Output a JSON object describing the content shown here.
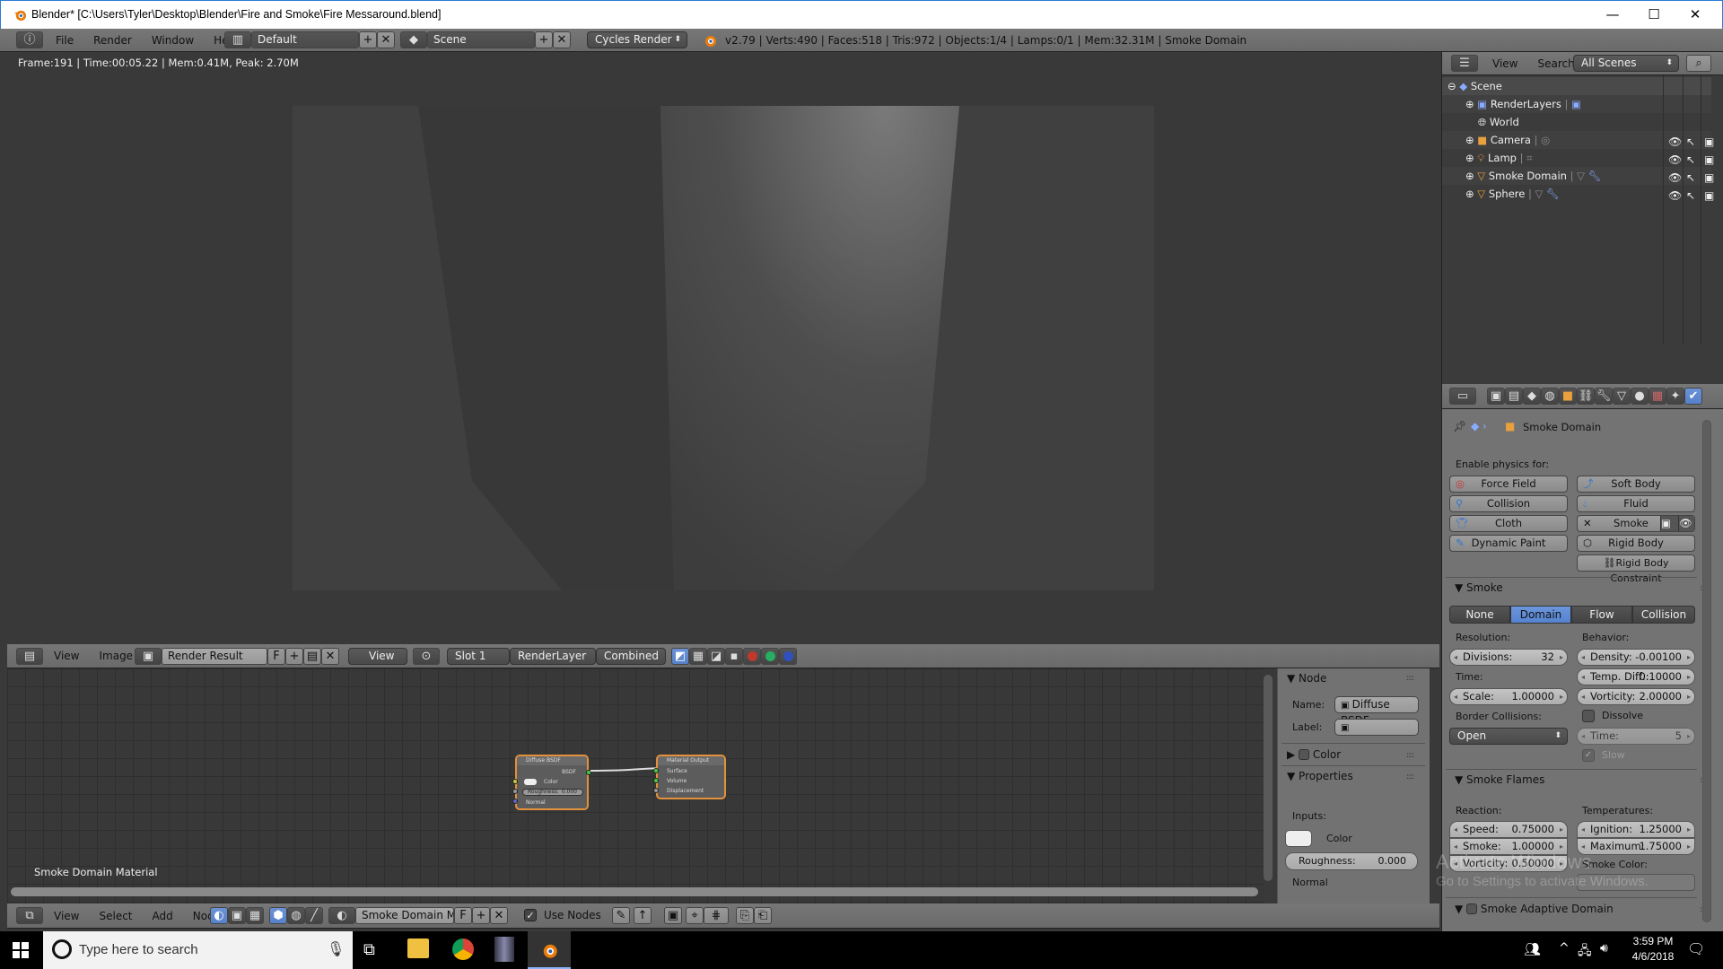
{
  "window": {
    "title": "Blender* [C:\\Users\\Tyler\\Desktop\\Blender\\Fire and Smoke\\Fire Messaround.blend]",
    "controls": {
      "minimize": "—",
      "maximize": "☐",
      "close": "✕"
    }
  },
  "info_header": {
    "menus": [
      "File",
      "Render",
      "Window",
      "Help"
    ],
    "layout": "Default",
    "scene": "Scene",
    "engine": "Cycles Render",
    "stats": "v2.79 | Verts:490 | Faces:518 | Tris:972 | Objects:1/4 | Lamps:0/1 | Mem:32.31M | Smoke Domain"
  },
  "viewport": {
    "render_info": "Frame:191 | Time:00:05.22 | Mem:0.41M, Peak: 2.70M"
  },
  "image_editor_header": {
    "menus": [
      "View",
      "Image"
    ],
    "image_name": "Render Result",
    "fake_user": "F",
    "view_dropdown": "View",
    "slot": "Slot 1",
    "render_layer": "RenderLayer",
    "pass": "Combined",
    "channel_colors": [
      "#c0392b",
      "#27ae60",
      "#3050c0"
    ]
  },
  "node_editor": {
    "material_label": "Smoke Domain Material",
    "nodes": {
      "diffuse": {
        "title": "Diffuse BSDF",
        "output": "BSDF",
        "color_label": "Color",
        "roughness_label": "Roughness:",
        "roughness_value": "0.000",
        "normal_label": "Normal"
      },
      "output": {
        "title": "Material Output",
        "inputs": [
          "Surface",
          "Volume",
          "Displacement"
        ]
      }
    }
  },
  "node_panel": {
    "node_section": "Node",
    "name_label": "Name:",
    "name_value": "Diffuse BSDF",
    "label_label": "Label:",
    "label_value": "",
    "color_section": "Color",
    "properties_section": "Properties",
    "inputs_label": "Inputs:",
    "color_label": "Color",
    "roughness_label": "Roughness:",
    "roughness_value": "0.000",
    "normal_label": "Normal"
  },
  "node_header": {
    "menus": [
      "View",
      "Select",
      "Add",
      "Node"
    ],
    "material": "Smoke Domain Mat...",
    "fake_user": "F",
    "use_nodes_label": "Use Nodes",
    "use_nodes_checked": true
  },
  "outliner": {
    "menus": [
      "View",
      "Search"
    ],
    "filter": "All Scenes",
    "items": [
      {
        "label": "Scene",
        "level": 0
      },
      {
        "label": "RenderLayers",
        "level": 1
      },
      {
        "label": "World",
        "level": 1
      },
      {
        "label": "Camera",
        "level": 1
      },
      {
        "label": "Lamp",
        "level": 1
      },
      {
        "label": "Smoke Domain",
        "level": 1
      },
      {
        "label": "Sphere",
        "level": 1
      }
    ]
  },
  "properties": {
    "context_object": "Smoke Domain",
    "enable_physics_label": "Enable physics for:",
    "physics_buttons": {
      "force_field": "Force Field",
      "soft_body": "Soft Body",
      "collision": "Collision",
      "fluid": "Fluid",
      "cloth": "Cloth",
      "smoke": "Smoke",
      "dynamic_paint": "Dynamic Paint",
      "rigid_body": "Rigid Body",
      "rigid_body_constraint": "Rigid Body Constraint"
    },
    "smoke": {
      "title": "Smoke",
      "types": [
        "None",
        "Domain",
        "Flow",
        "Collision"
      ],
      "active_type": "Domain",
      "resolution_label": "Resolution:",
      "divisions_label": "Divisions:",
      "divisions_value": "32",
      "time_label": "Time:",
      "scale_label": "Scale:",
      "scale_value": "1.00000",
      "border_label": "Border Collisions:",
      "border_value": "Open",
      "behavior_label": "Behavior:",
      "density_label": "Density:",
      "density_value": "-0.00100",
      "temp_label": "Temp. Diff.:",
      "temp_value": "0.10000",
      "vorticity_label": "Vorticity:",
      "vorticity_value": "2.00000",
      "dissolve_label": "Dissolve",
      "dissolve_checked": false,
      "dtime_label": "Time:",
      "dtime_value": "5",
      "slow_label": "Slow",
      "slow_checked": true
    },
    "flames": {
      "title": "Smoke Flames",
      "reaction_label": "Reaction:",
      "speed_label": "Speed:",
      "speed_value": "0.75000",
      "smoke_label": "Smoke:",
      "smoke_value": "1.00000",
      "vorticity_label": "Vorticity:",
      "vorticity_value": "0.50000",
      "temperatures_label": "Temperatures:",
      "ignition_label": "Ignition:",
      "ignition_value": "1.25000",
      "maximum_label": "Maximum:",
      "maximum_value": "1.75000",
      "smoke_color_label": "Smoke Color:"
    },
    "adaptive": {
      "title": "Smoke Adaptive Domain",
      "checked": false
    }
  },
  "watermark": {
    "line1": "Activate Windows",
    "line2": "Go to Settings to activate Windows."
  },
  "taskbar": {
    "search_placeholder": "Type here to search",
    "time": "3:59 PM",
    "date": "4/6/2018"
  }
}
